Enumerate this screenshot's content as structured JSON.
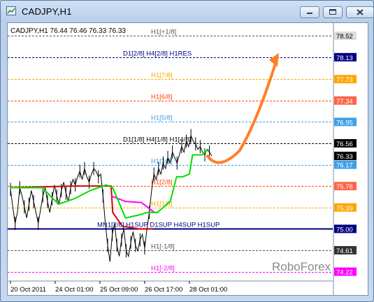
{
  "window": {
    "title": "CADJPY,H1",
    "buttons": [
      "minimize",
      "maximize",
      "close"
    ]
  },
  "chart_data": {
    "type": "line",
    "symbol_header": "CADJPY,H1  76.44 76.46 76.33 76.33",
    "watermark": "RoboForex",
    "ylim": [
      74.1,
      78.65
    ],
    "x_tick_labels": [
      "20 Oct 2011",
      "24 Oct 01:00",
      "25 Oct 09:00",
      "26 Oct 17:00",
      "28 Oct 01:00"
    ],
    "y_axis_labels": [
      {
        "value": 78.52,
        "text": "78.52",
        "bg": "#dcdcdc",
        "color": "#000"
      },
      {
        "value": 78.13,
        "text": "78.13",
        "bg": "#000080",
        "color": "#fff"
      },
      {
        "value": 77.73,
        "text": "77.73",
        "bg": "#ffa500",
        "color": "#fff"
      },
      {
        "value": 77.34,
        "text": "77.34",
        "bg": "#ff6347",
        "color": "#fff"
      },
      {
        "value": 76.95,
        "text": "76.95",
        "bg": "#3f9fe6",
        "color": "#fff"
      },
      {
        "value": 76.56,
        "text": "76.56",
        "bg": "#000000",
        "color": "#fff"
      },
      {
        "value": 76.33,
        "text": "76.33",
        "bg": "#000000",
        "color": "#fff"
      },
      {
        "value": 76.17,
        "text": "76.17",
        "bg": "#3f9fe6",
        "color": "#fff"
      },
      {
        "value": 75.78,
        "text": "75.78",
        "bg": "#ff6347",
        "color": "#fff"
      },
      {
        "value": 75.39,
        "text": "75.39",
        "bg": "#ffa500",
        "color": "#fff"
      },
      {
        "value": 75.0,
        "text": "75.00",
        "bg": "#000080",
        "color": "#fff"
      },
      {
        "value": 74.61,
        "text": "74.61",
        "bg": "#333333",
        "color": "#fff"
      },
      {
        "value": 74.22,
        "text": "74.22",
        "bg": "#ff00ff",
        "color": "#fff"
      }
    ],
    "levels": [
      {
        "value": 78.52,
        "label": "H1[+1/8]",
        "color": "#555555",
        "solid": false
      },
      {
        "value": 78.13,
        "label": "D1[2/8] H4[2/8] H1RES",
        "color": "#000080",
        "solid": false
      },
      {
        "value": 77.73,
        "label": "H1[7/8]",
        "color": "#ffa500",
        "solid": false
      },
      {
        "value": 77.34,
        "label": "H1[6/8]",
        "color": "#ff4500",
        "solid": false
      },
      {
        "value": 76.95,
        "label": "H1[5/8]",
        "color": "#3f9fe6",
        "solid": false
      },
      {
        "value": 76.56,
        "label": "D1[1/8] H4[1/8] H1[4/8]",
        "color": "#000000",
        "solid": false
      },
      {
        "value": 76.17,
        "label": "H1[3/8]",
        "color": "#3f9fe6",
        "solid": false
      },
      {
        "value": 75.78,
        "label": "H1[2/8]",
        "color": "#ff4500",
        "solid": false
      },
      {
        "value": 75.39,
        "label": "H1[1/8]",
        "color": "#ffa500",
        "solid": false
      },
      {
        "value": 75.0,
        "label": "MN1[2/8] H1SUP D1SUP H4SUP H1SUP",
        "color": "#000080",
        "solid": true
      },
      {
        "value": 74.61,
        "label": "H1[-1/8]",
        "color": "#555555",
        "solid": false
      },
      {
        "value": 74.22,
        "label": "H1[-2/8]",
        "color": "#ff00ff",
        "solid": false
      }
    ],
    "price": [
      75.72,
      75.4,
      75.1,
      75.3,
      75.75,
      75.6,
      75.4,
      75.2,
      75.45,
      75.7,
      75.5,
      75.3,
      75.1,
      75.35,
      75.6,
      75.75,
      75.5,
      75.3,
      75.55,
      75.8,
      75.6,
      75.45,
      75.7,
      75.85,
      75.65,
      75.5,
      75.75,
      75.9,
      75.8,
      75.95,
      76.05,
      75.9,
      76.1,
      75.95,
      75.85,
      76.0,
      76.1,
      76.05,
      75.95,
      76.0,
      75.6,
      75.1,
      74.7,
      74.4,
      74.9,
      75.1,
      74.7,
      74.5,
      74.8,
      75.0,
      74.6,
      74.5,
      74.75,
      74.95,
      74.7,
      74.6,
      74.8,
      74.9,
      74.65,
      75.0,
      75.3,
      75.7,
      76.0,
      75.9,
      76.1,
      76.0,
      76.2,
      76.1,
      76.3,
      76.2,
      76.4,
      76.3,
      76.2,
      76.35,
      76.5,
      76.4,
      76.6,
      76.5,
      76.7,
      76.6,
      76.55,
      76.45,
      76.5,
      76.4,
      76.35,
      76.45,
      76.4,
      76.33
    ],
    "trend_line": [
      {
        "t": 0,
        "v": 75.75
      },
      {
        "t": 0.2,
        "v": 75.78
      },
      {
        "t": 0.315,
        "v": 75.78
      },
      {
        "t": 0.32,
        "v": 75.3
      },
      {
        "t": 0.35,
        "v": 75.05
      },
      {
        "t": 0.4,
        "v": 75.0
      },
      {
        "t": 0.445,
        "v": 75.0
      }
    ],
    "magenta_line": [
      {
        "t": 0.315,
        "v": 75.6
      },
      {
        "t": 0.36,
        "v": 75.5
      },
      {
        "t": 0.41,
        "v": 75.48
      },
      {
        "t": 0.45,
        "v": 75.3
      },
      {
        "t": 0.46,
        "v": 75.3
      }
    ],
    "green_line": [
      {
        "t": 0,
        "v": 75.75
      },
      {
        "t": 0.05,
        "v": 75.75
      },
      {
        "t": 0.1,
        "v": 75.75
      },
      {
        "t": 0.15,
        "v": 75.45
      },
      {
        "t": 0.2,
        "v": 75.55
      },
      {
        "t": 0.25,
        "v": 75.7
      },
      {
        "t": 0.3,
        "v": 75.8
      },
      {
        "t": 0.32,
        "v": 75.75
      },
      {
        "t": 0.36,
        "v": 75.2
      },
      {
        "t": 0.4,
        "v": 75.25
      },
      {
        "t": 0.43,
        "v": 75.3
      },
      {
        "t": 0.46,
        "v": 75.3
      },
      {
        "t": 0.5,
        "v": 75.5
      },
      {
        "t": 0.52,
        "v": 75.95
      },
      {
        "t": 0.54,
        "v": 75.95
      },
      {
        "t": 0.56,
        "v": 76.0
      },
      {
        "t": 0.57,
        "v": 76.35
      },
      {
        "t": 0.6,
        "v": 76.35
      },
      {
        "t": 0.62,
        "v": 76.45
      }
    ],
    "forecast_arrow": {
      "color": "#ff7f27"
    }
  }
}
